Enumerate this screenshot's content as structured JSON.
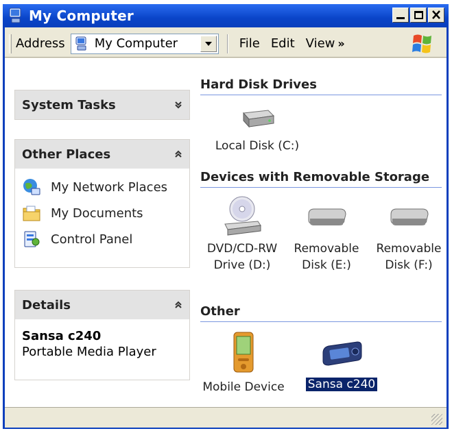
{
  "window": {
    "title": "My Computer"
  },
  "toolbar": {
    "address_label": "Address",
    "address_value": "My Computer",
    "menus": [
      "File",
      "Edit",
      "View"
    ],
    "overflow": "»"
  },
  "left_pane": {
    "system_tasks": {
      "title": "System Tasks",
      "chevron": "»"
    },
    "other_places": {
      "title": "Other Places",
      "chevron": "«",
      "items": [
        {
          "label": "My Network Places",
          "icon": "network-places-icon"
        },
        {
          "label": "My Documents",
          "icon": "documents-folder-icon"
        },
        {
          "label": "Control Panel",
          "icon": "control-panel-icon"
        }
      ]
    },
    "details": {
      "title": "Details",
      "chevron": "«",
      "name": "Sansa c240",
      "type": "Portable Media Player"
    }
  },
  "right_pane": {
    "hard_disk_drives": {
      "title": "Hard Disk Drives",
      "items": [
        {
          "label": "Local Disk (C:)",
          "icon": "hard-disk-icon"
        }
      ]
    },
    "removable": {
      "title": "Devices with Removable Storage",
      "items": [
        {
          "label_line1": "DVD/CD-RW",
          "label_line2": "Drive (D:)",
          "icon": "cd-drive-icon"
        },
        {
          "label_line1": "Removable",
          "label_line2": "Disk (E:)",
          "icon": "removable-disk-icon"
        },
        {
          "label_line1": "Removable",
          "label_line2": "Disk (F:)",
          "icon": "removable-disk-icon"
        }
      ]
    },
    "other": {
      "title": "Other",
      "items": [
        {
          "label": "Mobile Device",
          "icon": "mobile-device-icon"
        },
        {
          "label": "Sansa c240",
          "icon": "media-player-icon",
          "selected": true
        }
      ]
    }
  },
  "colors": {
    "title_bar": "#0a3fbd",
    "selection": "#0a246a",
    "section_rule": "#7a96df"
  }
}
